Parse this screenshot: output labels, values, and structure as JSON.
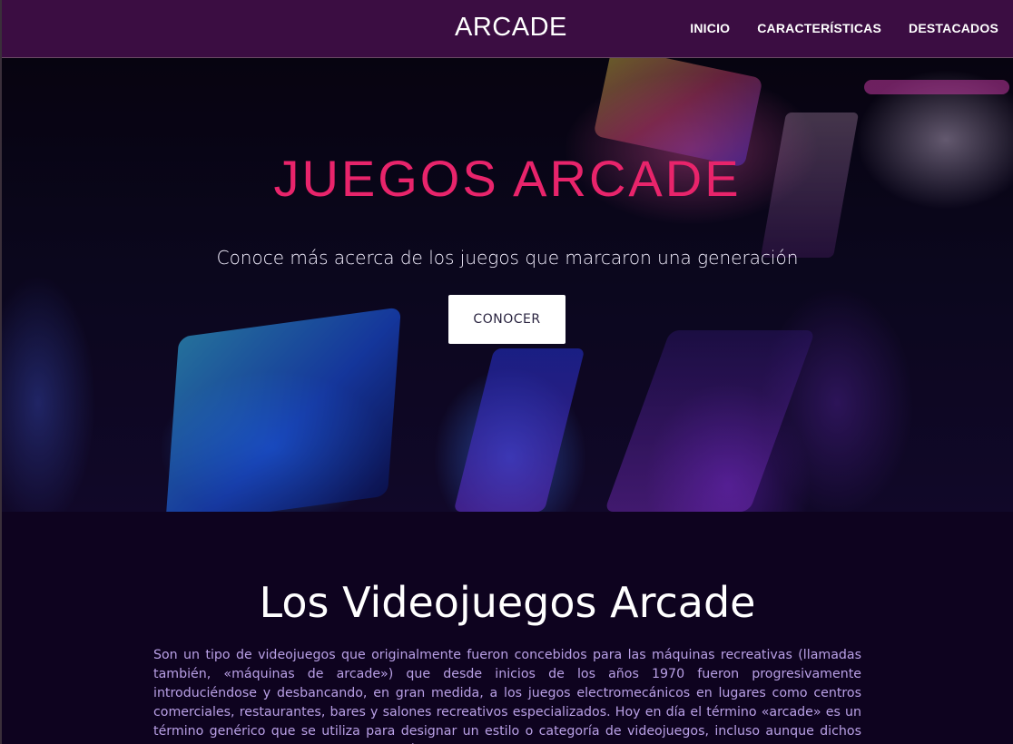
{
  "navbar": {
    "brand": "ARCADE",
    "links": [
      {
        "label": "INICIO"
      },
      {
        "label": "CARACTERÍSTICAS"
      },
      {
        "label": "DESTACADOS"
      }
    ],
    "background_color": "#3b0d42"
  },
  "hero": {
    "title": "JUEGOS ARCADE",
    "subtitle": "Conoce más acerca de los juegos que marcaron una generación",
    "button_label": "CONOCER",
    "title_color": "#e8246b"
  },
  "section": {
    "title": "Los Videojuegos Arcade",
    "paragraph": "Son un tipo de videojuegos que originalmente fueron concebidos para las máquinas recreativas (llamadas también, «máquinas de arcade») que desde inicios de los años 1970 fueron progresivamente introduciéndose y desbancando, en gran medida, a los juegos electromecánicos en lugares como centros comerciales, restaurantes, bares y salones recreativos especializados. Hoy en día el término «arcade» es un término genérico que se utiliza para designar un estilo o categoría de videojuegos, incluso aunque dichos videojuegos ya no sean utilizados en máquinas recreativas sino a nivel",
    "text_color": "#b9a0e6",
    "background_color": "#0e031f"
  }
}
